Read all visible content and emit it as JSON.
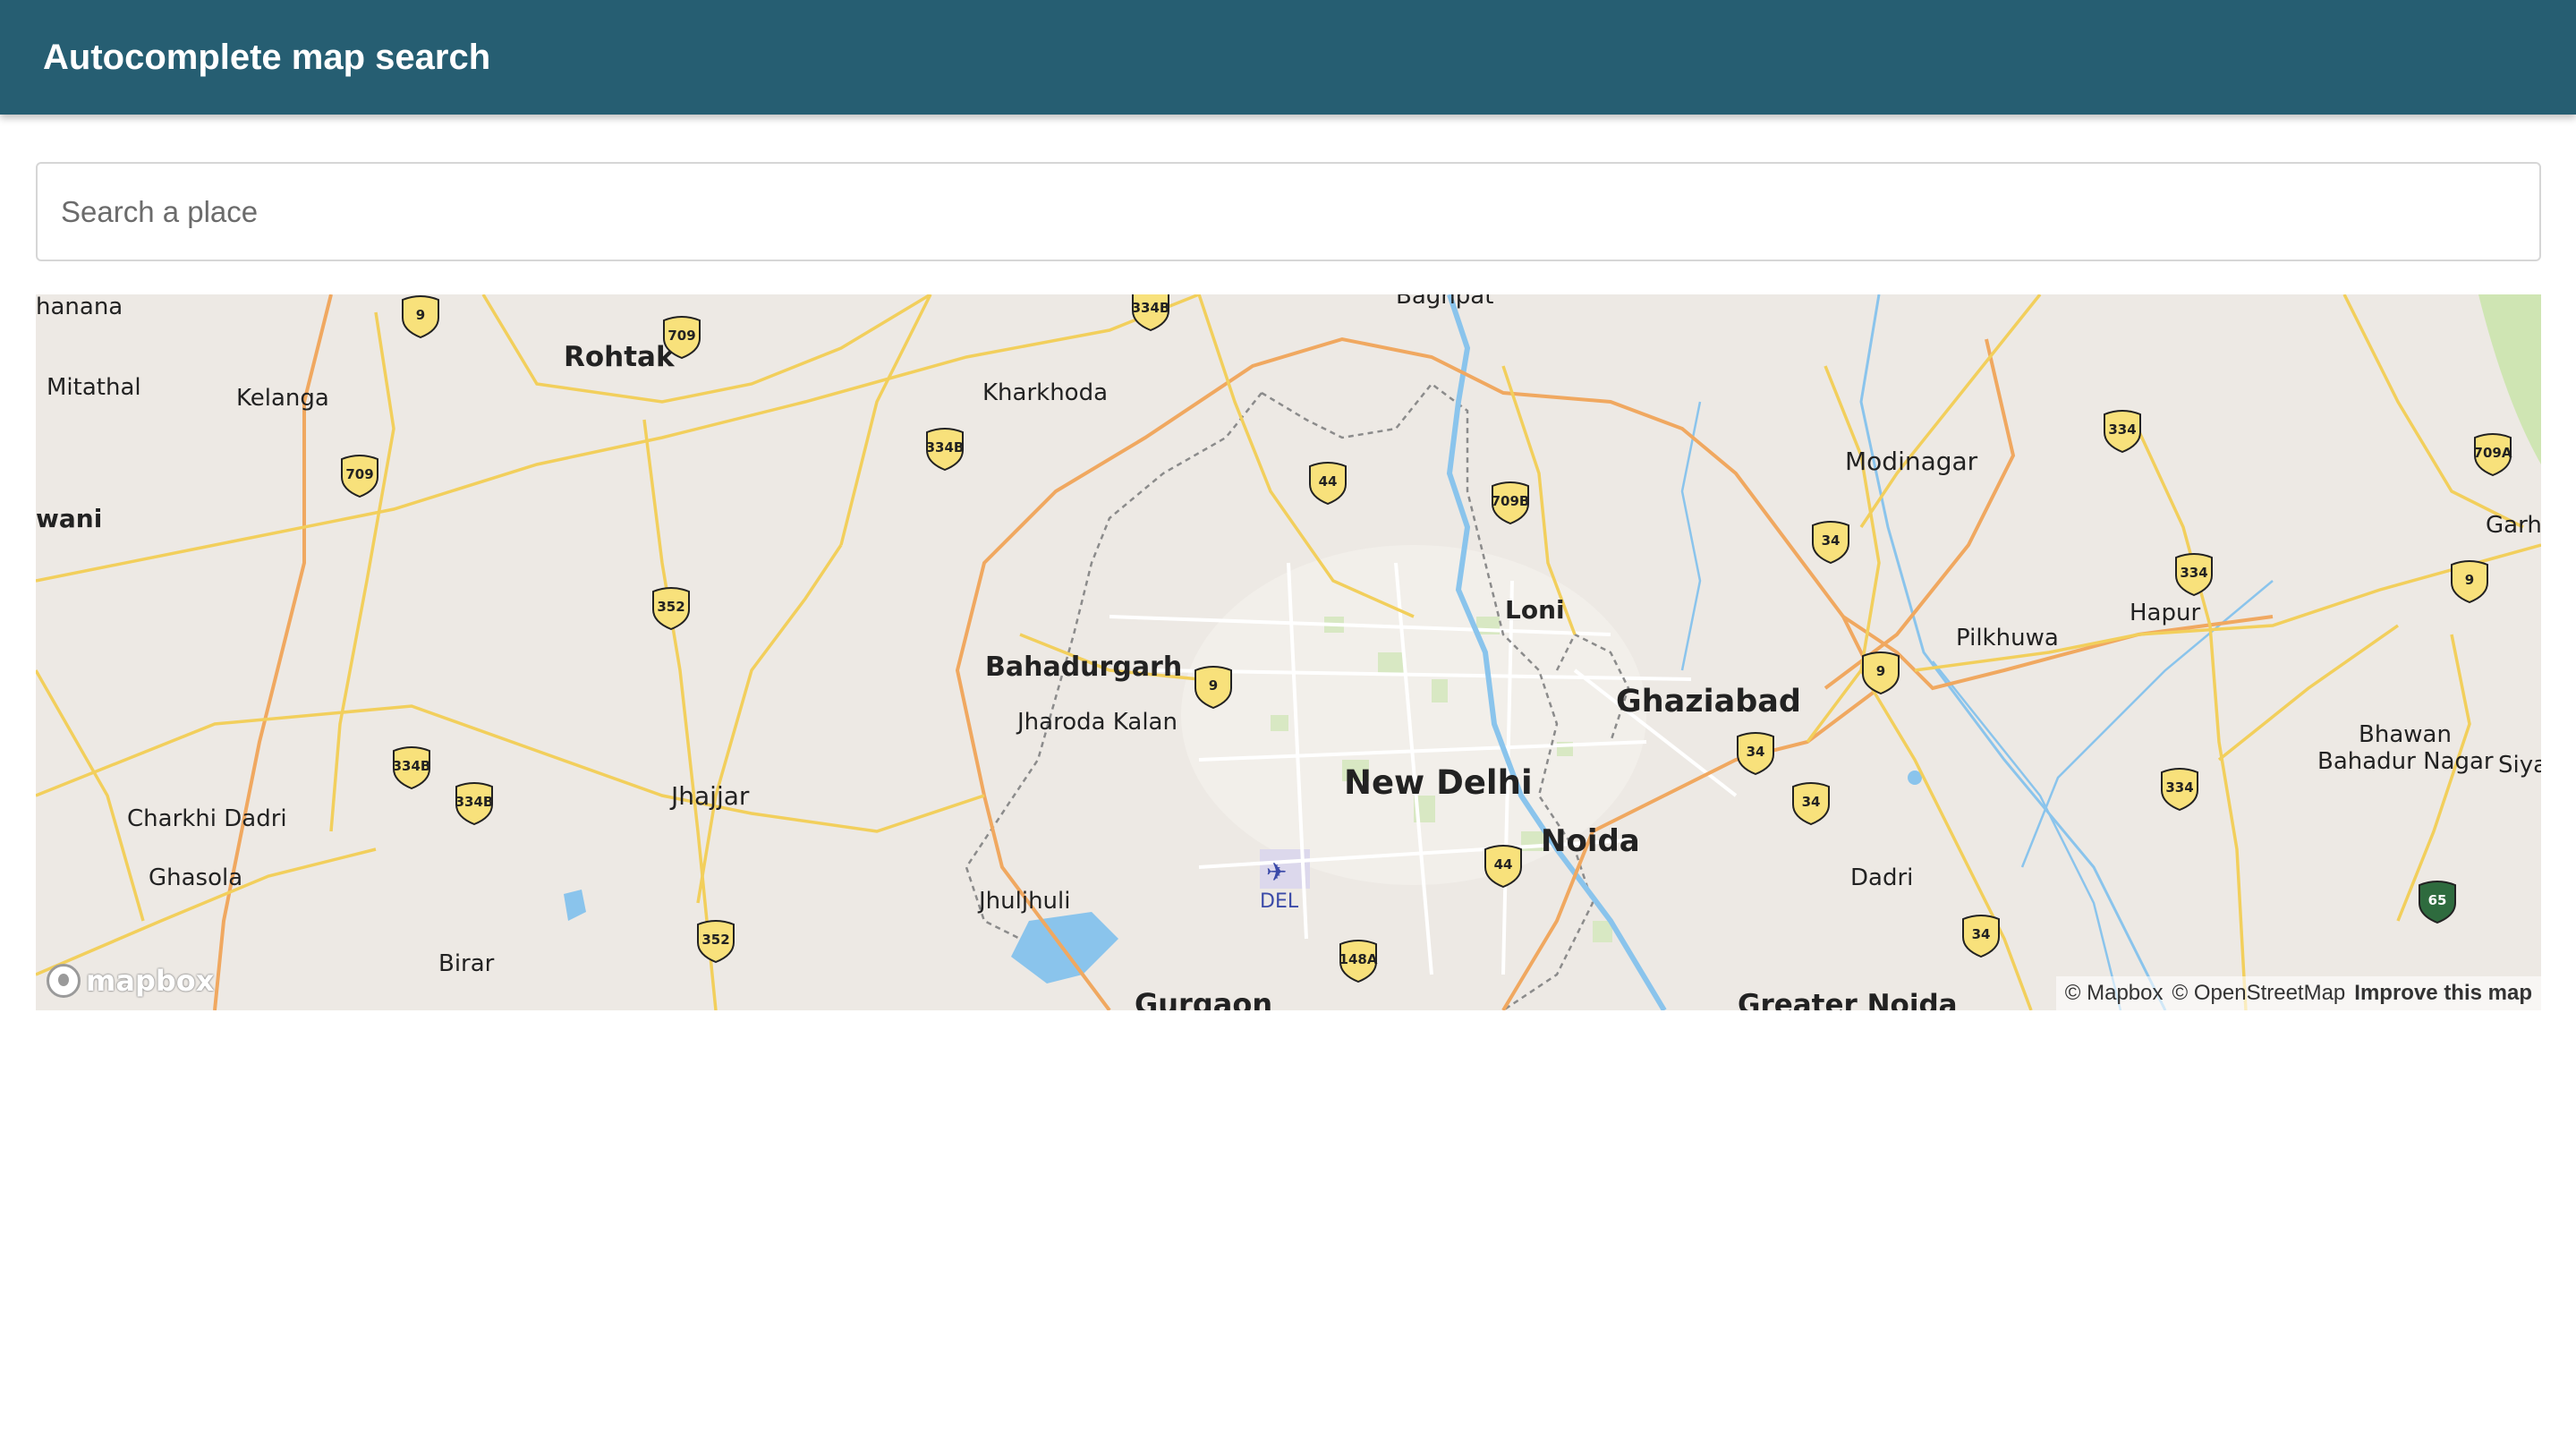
{
  "app_bar": {
    "title": "Autocomplete map search"
  },
  "search": {
    "placeholder": "Search a place",
    "value": ""
  },
  "map": {
    "places": {
      "hanana": "hanana",
      "mitathal": "Mitathal",
      "kelanga": "Kelanga",
      "wani": "wani",
      "rohtak": "Rohtak",
      "kharkhoda": "Kharkhoda",
      "baghpat": "Baghpat",
      "modinagar": "Modinagar",
      "garhm": "Garhm",
      "loni": "Loni",
      "bahadurgarh": "Bahadurgarh",
      "jharoda_kalan": "Jharoda Kalan",
      "ghaziabad": "Ghaziabad",
      "pilkhuwa": "Pilkhuwa",
      "hapur": "Hapur",
      "bhawan": "Bhawan",
      "bahadur_nagar": "Bahadur Nagar",
      "siya": "Siya",
      "new_delhi": "New Delhi",
      "noida": "Noida",
      "charkhi_dadri": "Charkhi Dadri",
      "jhajjar": "Jhajjar",
      "ghasola": "Ghasola",
      "jhuljhuli": "Jhuljhuli",
      "del": "DEL",
      "dadri": "Dadri",
      "birar": "Birar",
      "gurgaon": "Gurgaon",
      "greater_noida": "Greater Noida"
    },
    "shields": {
      "r9a": "9",
      "r709a": "709",
      "r334ba": "334B",
      "r334bb": "334B",
      "r709b": "709",
      "r352a": "352",
      "r44a": "44",
      "r709b_loni": "709B",
      "r9b": "9",
      "r334a": "334",
      "r34a": "34",
      "r334b": "334",
      "r709a_e": "709A",
      "r9c": "9",
      "r9d": "9",
      "r334bc": "334B",
      "r334bd": "334B",
      "r34b": "34",
      "r34c": "34",
      "r334c": "334",
      "r352b": "352",
      "r44b": "44",
      "r148a": "148A",
      "r34d": "34",
      "r65": "65"
    },
    "colors": {
      "land": "#ede9e4",
      "road": "#f2cf5c",
      "highway": "#f0a860",
      "water": "#8ac4ec",
      "park": "#cfe5b3"
    },
    "attribution": {
      "mapbox": "© Mapbox",
      "osm": "© OpenStreetMap",
      "improve": "Improve this map"
    },
    "logo_text": "mapbox"
  }
}
